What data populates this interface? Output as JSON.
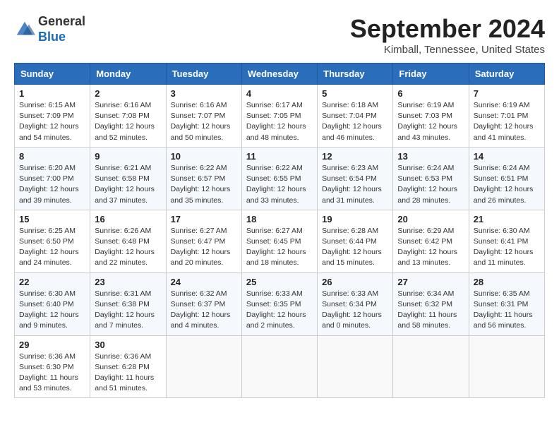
{
  "header": {
    "logo_general": "General",
    "logo_blue": "Blue",
    "month": "September 2024",
    "location": "Kimball, Tennessee, United States"
  },
  "weekdays": [
    "Sunday",
    "Monday",
    "Tuesday",
    "Wednesday",
    "Thursday",
    "Friday",
    "Saturday"
  ],
  "weeks": [
    [
      {
        "day": "1",
        "info": "Sunrise: 6:15 AM\nSunset: 7:09 PM\nDaylight: 12 hours\nand 54 minutes."
      },
      {
        "day": "2",
        "info": "Sunrise: 6:16 AM\nSunset: 7:08 PM\nDaylight: 12 hours\nand 52 minutes."
      },
      {
        "day": "3",
        "info": "Sunrise: 6:16 AM\nSunset: 7:07 PM\nDaylight: 12 hours\nand 50 minutes."
      },
      {
        "day": "4",
        "info": "Sunrise: 6:17 AM\nSunset: 7:05 PM\nDaylight: 12 hours\nand 48 minutes."
      },
      {
        "day": "5",
        "info": "Sunrise: 6:18 AM\nSunset: 7:04 PM\nDaylight: 12 hours\nand 46 minutes."
      },
      {
        "day": "6",
        "info": "Sunrise: 6:19 AM\nSunset: 7:03 PM\nDaylight: 12 hours\nand 43 minutes."
      },
      {
        "day": "7",
        "info": "Sunrise: 6:19 AM\nSunset: 7:01 PM\nDaylight: 12 hours\nand 41 minutes."
      }
    ],
    [
      {
        "day": "8",
        "info": "Sunrise: 6:20 AM\nSunset: 7:00 PM\nDaylight: 12 hours\nand 39 minutes."
      },
      {
        "day": "9",
        "info": "Sunrise: 6:21 AM\nSunset: 6:58 PM\nDaylight: 12 hours\nand 37 minutes."
      },
      {
        "day": "10",
        "info": "Sunrise: 6:22 AM\nSunset: 6:57 PM\nDaylight: 12 hours\nand 35 minutes."
      },
      {
        "day": "11",
        "info": "Sunrise: 6:22 AM\nSunset: 6:55 PM\nDaylight: 12 hours\nand 33 minutes."
      },
      {
        "day": "12",
        "info": "Sunrise: 6:23 AM\nSunset: 6:54 PM\nDaylight: 12 hours\nand 31 minutes."
      },
      {
        "day": "13",
        "info": "Sunrise: 6:24 AM\nSunset: 6:53 PM\nDaylight: 12 hours\nand 28 minutes."
      },
      {
        "day": "14",
        "info": "Sunrise: 6:24 AM\nSunset: 6:51 PM\nDaylight: 12 hours\nand 26 minutes."
      }
    ],
    [
      {
        "day": "15",
        "info": "Sunrise: 6:25 AM\nSunset: 6:50 PM\nDaylight: 12 hours\nand 24 minutes."
      },
      {
        "day": "16",
        "info": "Sunrise: 6:26 AM\nSunset: 6:48 PM\nDaylight: 12 hours\nand 22 minutes."
      },
      {
        "day": "17",
        "info": "Sunrise: 6:27 AM\nSunset: 6:47 PM\nDaylight: 12 hours\nand 20 minutes."
      },
      {
        "day": "18",
        "info": "Sunrise: 6:27 AM\nSunset: 6:45 PM\nDaylight: 12 hours\nand 18 minutes."
      },
      {
        "day": "19",
        "info": "Sunrise: 6:28 AM\nSunset: 6:44 PM\nDaylight: 12 hours\nand 15 minutes."
      },
      {
        "day": "20",
        "info": "Sunrise: 6:29 AM\nSunset: 6:42 PM\nDaylight: 12 hours\nand 13 minutes."
      },
      {
        "day": "21",
        "info": "Sunrise: 6:30 AM\nSunset: 6:41 PM\nDaylight: 12 hours\nand 11 minutes."
      }
    ],
    [
      {
        "day": "22",
        "info": "Sunrise: 6:30 AM\nSunset: 6:40 PM\nDaylight: 12 hours\nand 9 minutes."
      },
      {
        "day": "23",
        "info": "Sunrise: 6:31 AM\nSunset: 6:38 PM\nDaylight: 12 hours\nand 7 minutes."
      },
      {
        "day": "24",
        "info": "Sunrise: 6:32 AM\nSunset: 6:37 PM\nDaylight: 12 hours\nand 4 minutes."
      },
      {
        "day": "25",
        "info": "Sunrise: 6:33 AM\nSunset: 6:35 PM\nDaylight: 12 hours\nand 2 minutes."
      },
      {
        "day": "26",
        "info": "Sunrise: 6:33 AM\nSunset: 6:34 PM\nDaylight: 12 hours\nand 0 minutes."
      },
      {
        "day": "27",
        "info": "Sunrise: 6:34 AM\nSunset: 6:32 PM\nDaylight: 11 hours\nand 58 minutes."
      },
      {
        "day": "28",
        "info": "Sunrise: 6:35 AM\nSunset: 6:31 PM\nDaylight: 11 hours\nand 56 minutes."
      }
    ],
    [
      {
        "day": "29",
        "info": "Sunrise: 6:36 AM\nSunset: 6:30 PM\nDaylight: 11 hours\nand 53 minutes."
      },
      {
        "day": "30",
        "info": "Sunrise: 6:36 AM\nSunset: 6:28 PM\nDaylight: 11 hours\nand 51 minutes."
      },
      {
        "day": "",
        "info": ""
      },
      {
        "day": "",
        "info": ""
      },
      {
        "day": "",
        "info": ""
      },
      {
        "day": "",
        "info": ""
      },
      {
        "day": "",
        "info": ""
      }
    ]
  ]
}
